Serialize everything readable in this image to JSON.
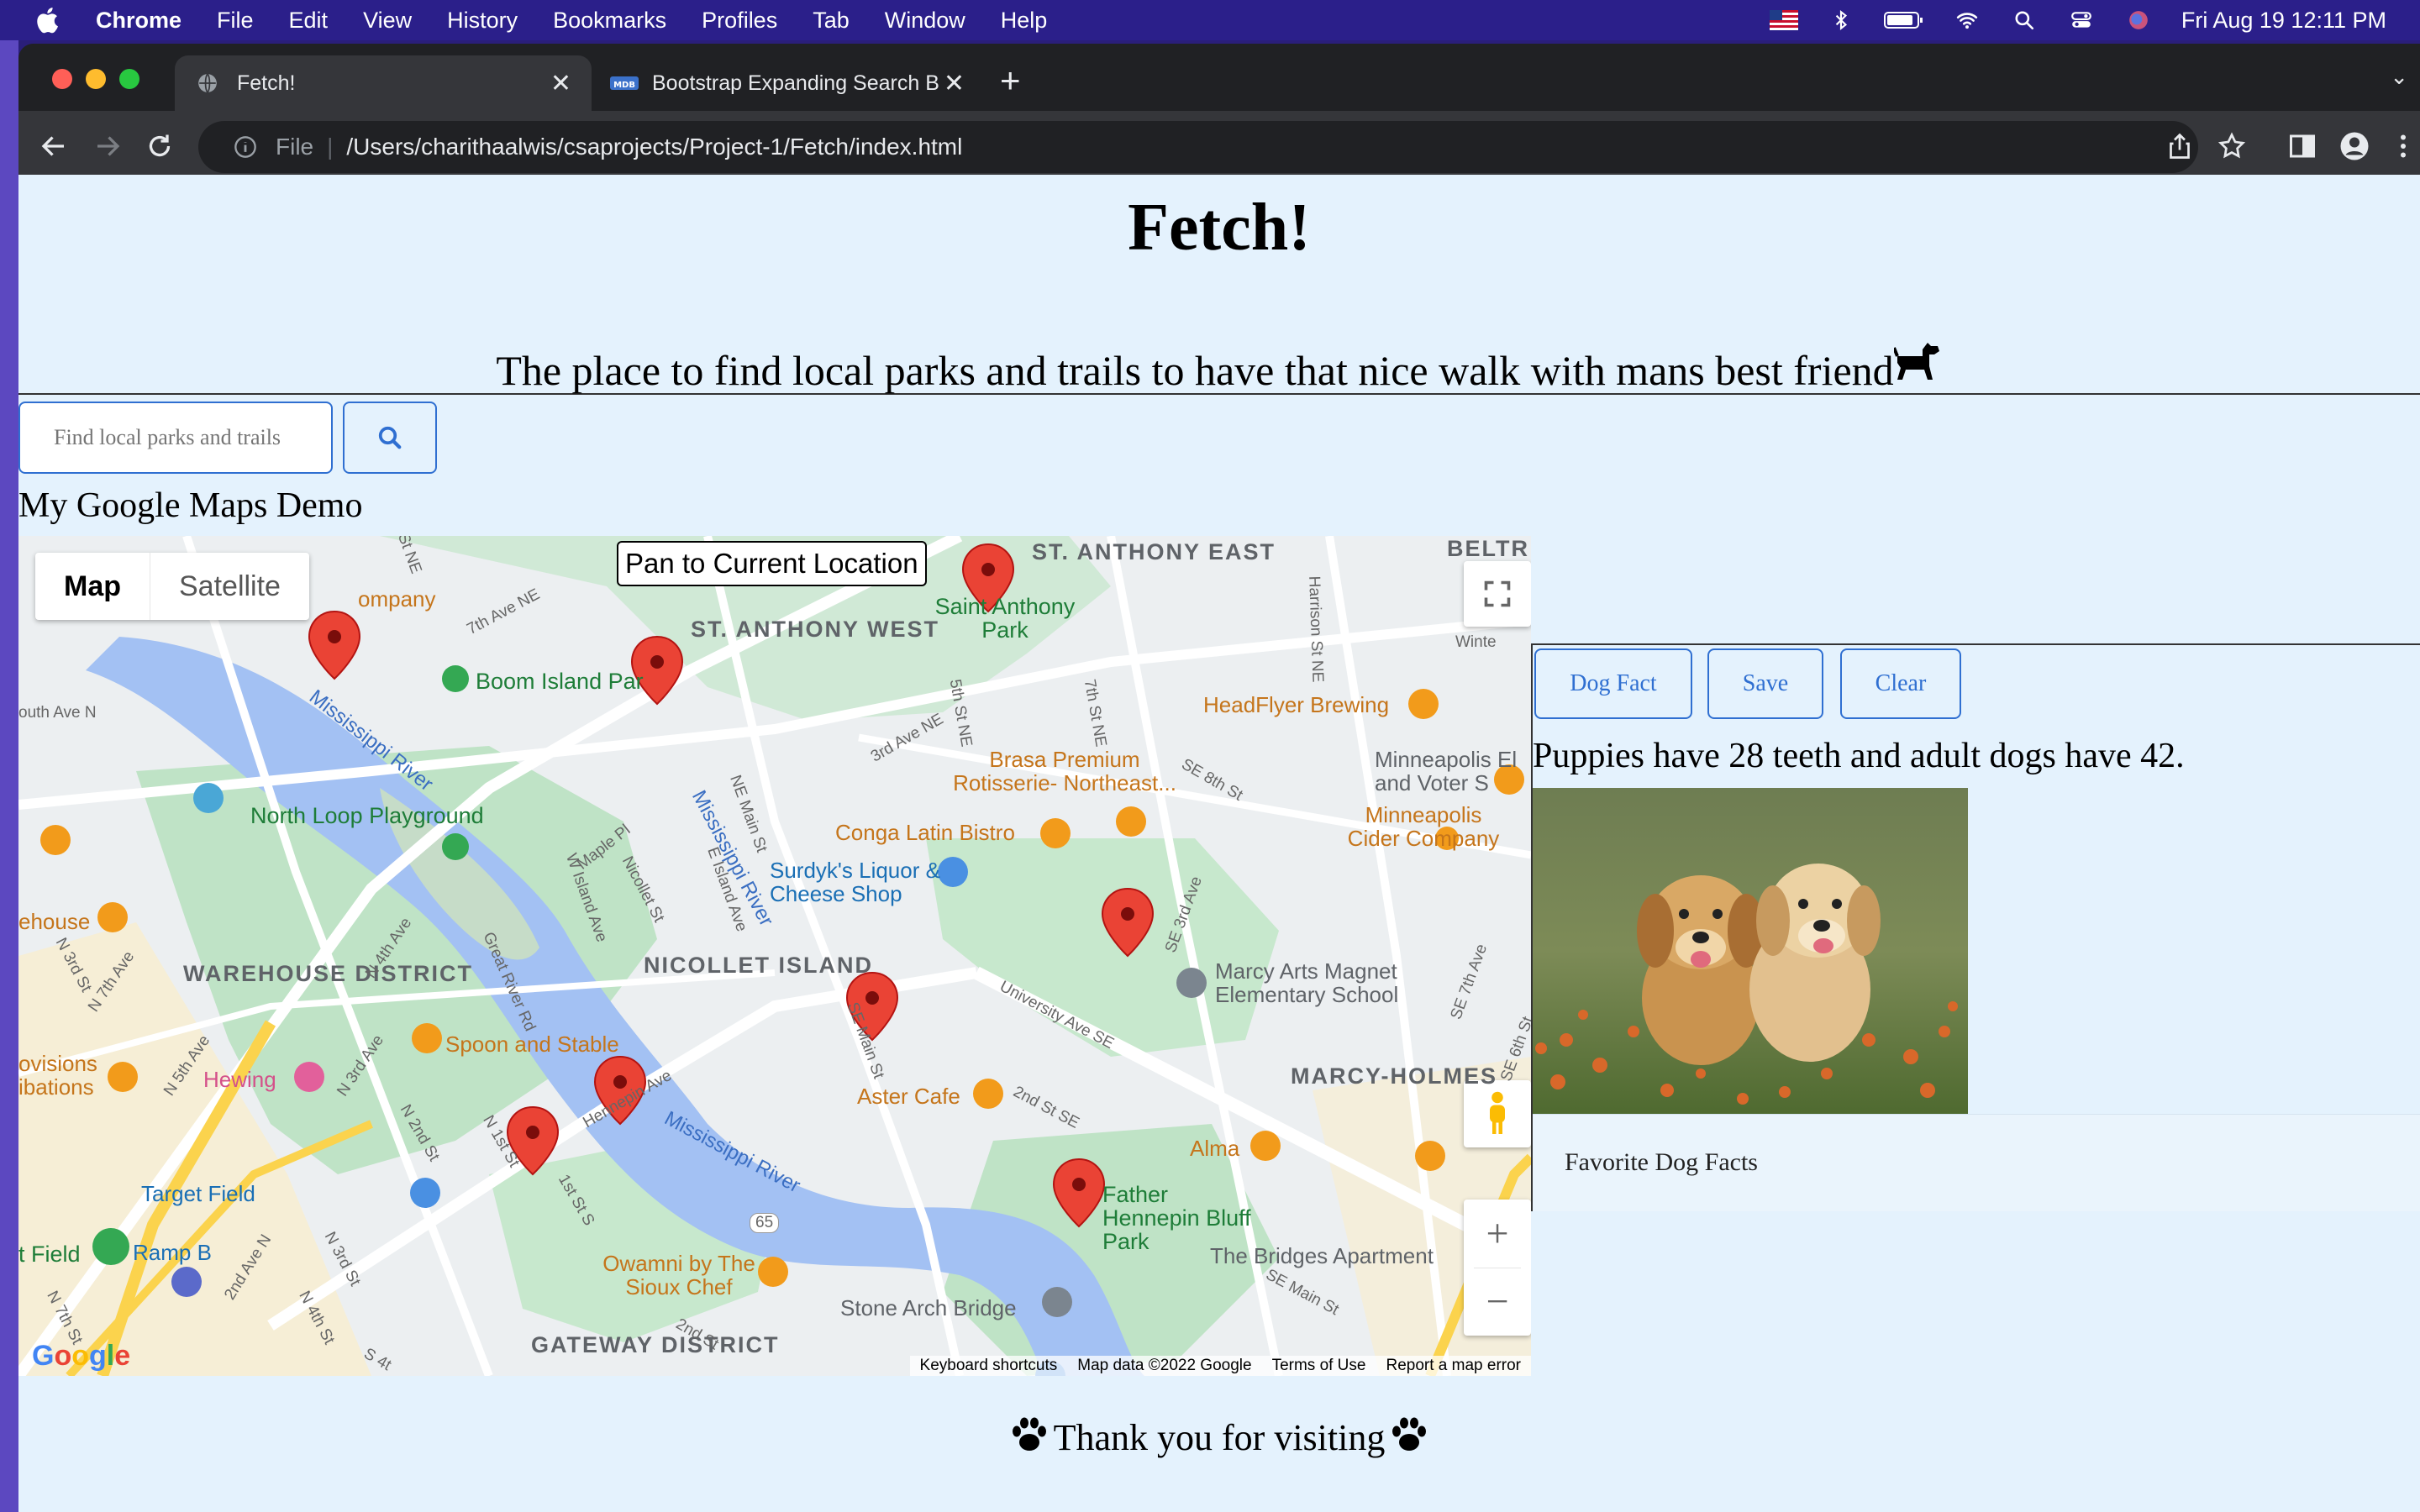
{
  "menubar": {
    "app": "Chrome",
    "items": [
      "File",
      "Edit",
      "View",
      "History",
      "Bookmarks",
      "Profiles",
      "Tab",
      "Window",
      "Help"
    ],
    "clock": "Fri Aug 19  12:11 PM"
  },
  "browser": {
    "tabs": [
      {
        "title": "Fetch!"
      },
      {
        "title": "Bootstrap Expanding Search B"
      }
    ],
    "url_scheme": "File",
    "url": "/Users/charithaalwis/csaprojects/Project-1/Fetch/index.html"
  },
  "page": {
    "title": "Fetch!",
    "tagline": "The place to find local parks and trails to have that nice walk with mans best friend",
    "search_placeholder": "Find local parks and trails",
    "map_heading": "My Google Maps Demo",
    "footer_text": "Thank you for visiting"
  },
  "map": {
    "type_map": "Map",
    "type_satellite": "Satellite",
    "pan_button": "Pan to Current Location",
    "footer": {
      "shortcuts": "Keyboard shortcuts",
      "data": "Map data ©2022 Google",
      "terms": "Terms of Use",
      "report": "Report a map error"
    },
    "areas": {
      "st_anthony_east": "ST. ANTHONY EAST",
      "st_anthony_west": "ST. ANTHONY WEST",
      "warehouse_district": "WAREHOUSE DISTRICT",
      "nicollet_island": "NICOLLET ISLAND",
      "marcy_holmes": "MARCY-HOLMES",
      "gateway_district": "GATEWAY DISTRICT",
      "beltr": "BELTR"
    },
    "places": {
      "boom_island": "Boom Island Par",
      "saint_anthony_park": "Saint Anthony Park",
      "headflyer": "HeadFlyer Brewing",
      "brasa": "Brasa Premium Rotisserie- Northeast...",
      "minneapolis_elections": "Minneapolis El and Voter S",
      "cider": "Minneapolis Cider Company",
      "north_loop": "North Loop Playground",
      "conga": "Conga Latin Bistro",
      "surdyks": "Surdyk's Liquor & Cheese Shop",
      "marcy_arts": "Marcy Arts Magnet Elementary School",
      "spoon_stable": "Spoon and Stable",
      "hewing": "Hewing",
      "aster": "Aster Cafe",
      "alma": "Alma",
      "target_field": "Target Field",
      "father_hennepin": "Father Hennepin Bluff Park",
      "bridges": "The Bridges Apartment",
      "owamni": "Owamni by The Sioux Chef",
      "stone_arch": "Stone Arch Bridge",
      "ramp_b": "Ramp B",
      "t_field": "t Field",
      "company": "ompany",
      "ehouse": "ehouse",
      "ovisions": "ovisions ibations",
      "mississippi_river_1": "Mississippi River",
      "mississippi_river_2": "Mississippi River",
      "mississippi_river_3": "Mississippi River",
      "google": "Google"
    },
    "streets": {
      "seventh_ave_ne": "7th Ave NE",
      "fifth_st_ne": "5th St NE",
      "seventh_st_ne": "7th St NE",
      "ne_main_st": "NE Main St",
      "university_ave": "University Ave SE",
      "hennepin_ave": "Hennepin Ave",
      "great_river_rd": "Great River Rd",
      "se_8th_st": "SE 8th St",
      "harrison": "Harrison St NE",
      "third_ave_ne": "3rd Ave NE",
      "south_ave_n": "outh Ave N",
      "maple_pl": "Maple Pl",
      "nicollet_st": "Nicollet St",
      "w_island_ave": "W Island Ave",
      "e_island_ave": "E Island Ave",
      "se_main_st": "SE Main St",
      "second_st_se": "2nd St SE",
      "n_4th_ave": "N 4th Ave",
      "n_3rd_ave": "N 3rd Ave",
      "n_2nd_st": "N 2nd St",
      "n_1st_st": "N 1st St",
      "first_st_s": "1st St S",
      "second_ave_n": "2nd Ave N",
      "n_3rd_st": "N 3rd St",
      "n_4th_st": "N 4th St",
      "n_5th_ave": "N 5th Ave",
      "n_7th_ave": "N 7th Ave",
      "n_3rd_st_2": "N 3rd St",
      "n_7th_st": "N 7th St",
      "se_2nd_st": "SE 2nd St",
      "se_main_st_2": "SE Main St",
      "hwy_65": "65",
      "winter": "Winte",
      "s_4th": "S 4t",
      "second_st": "2nd St",
      "se_3rd_ave": "SE 3rd Ave",
      "se_7th_ave": "SE 7th Ave",
      "se_6th_st": "SE 6th St",
      "st_ne": "St NE"
    }
  },
  "panel": {
    "buttons": [
      "Dog Fact",
      "Save",
      "Clear"
    ],
    "fact": "Puppies have 28 teeth and adult dogs have 42.",
    "favorites_label": "Favorite Dog Facts"
  }
}
